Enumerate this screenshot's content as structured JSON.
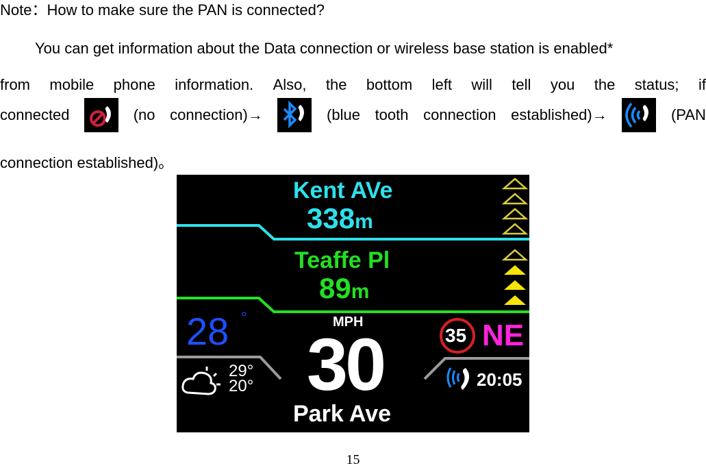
{
  "note": {
    "title": "Note：How to make sure the PAN is connected?",
    "line1": "You can get information about the Data connection or wireless base station is enabled*",
    "line2_words": [
      "from",
      "mobile",
      "phone",
      "information.",
      "Also,",
      "the",
      "bottom",
      "left",
      "will",
      "tell",
      "you",
      "the",
      "status;",
      "if"
    ],
    "line3": {
      "prefix": "connected",
      "no_connection_label": "(no",
      "no_connection_label2": "connection)→",
      "bluetooth_label": "(blue",
      "bluetooth_label2": "tooth",
      "bluetooth_label3": "connection",
      "bluetooth_label4": "established)→",
      "pan_label": "(PAN"
    },
    "line4": "connection established)。",
    "icons": [
      "no-connection-icon",
      "bluetooth-phone-icon",
      "pan-wireless-phone-icon"
    ]
  },
  "device": {
    "next_street": "Kent AVe",
    "next_distance": "338",
    "next_unit": "m",
    "turn_street": "Teaffe Pl",
    "turn_distance": "89",
    "turn_unit": "m",
    "temperature": "28",
    "temp_degree": "°",
    "forecast_high": "29°",
    "forecast_low": "20°",
    "speed_unit": "MPH",
    "speed": "30",
    "current_street": "Park Ave",
    "speed_limit": "35",
    "heading": "NE",
    "clock": "20:05",
    "lane_arrows_top": [
      "outline",
      "outline",
      "outline",
      "outline"
    ],
    "lane_arrows_bottom": [
      "outline",
      "filled",
      "filled",
      "filled"
    ],
    "colors": {
      "cyan": "#2ee0ea",
      "green": "#22e022",
      "blue": "#1f4fff",
      "magenta": "#ff22dd",
      "yellow": "#f5e40a",
      "red": "#d42020",
      "gray": "#9a9a9a"
    }
  },
  "page_number": "15"
}
